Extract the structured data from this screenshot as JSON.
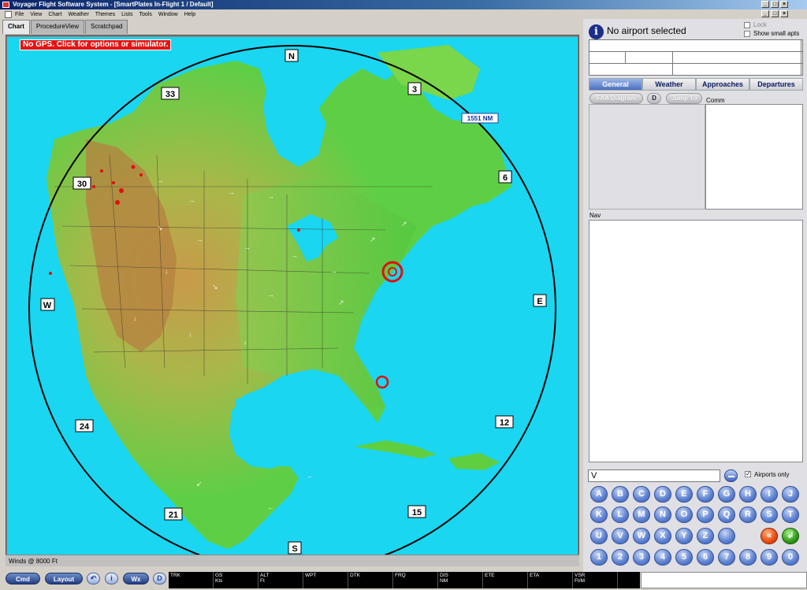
{
  "window": {
    "title": "Voyager Flight Software System - [SmartPlates In-Flight 1 / Default]",
    "min_glyph": "_",
    "max_glyph": "□",
    "close_glyph": "×"
  },
  "menu": [
    "File",
    "View",
    "Chart",
    "Weather",
    "Themes",
    "Lists",
    "Tools",
    "Window",
    "Help"
  ],
  "tabs": [
    {
      "label": "Chart",
      "active": true
    },
    {
      "label": "ProcedureView",
      "active": false
    },
    {
      "label": "Scratchpad",
      "active": false
    }
  ],
  "map": {
    "gps_banner": "No GPS.  Click for options or simulator.",
    "range_label": "1551 NM",
    "compass": {
      "n": "N",
      "e": "E",
      "s": "S",
      "w": "W"
    },
    "headings": [
      "3",
      "6",
      "12",
      "15",
      "21",
      "24",
      "30",
      "33"
    ],
    "winds_label": "Winds @ 8000 Ft",
    "colors": {
      "ocean": "#1ad6f0",
      "land_low": "#6ed34a",
      "land_high": "#c48a3a",
      "ring": "#000000",
      "marker": "#e01010"
    }
  },
  "toolbar": {
    "cmd": "Cmd",
    "layout": "Layout",
    "wx": "Wx",
    "cells": [
      {
        "l1": "TRK",
        "l2": ""
      },
      {
        "l1": "GS",
        "l2": "Kts"
      },
      {
        "l1": "ALT",
        "l2": "Ft"
      },
      {
        "l1": "WPT",
        "l2": ""
      },
      {
        "l1": "DTK",
        "l2": ""
      },
      {
        "l1": "FRQ",
        "l2": ""
      },
      {
        "l1": "DIS",
        "l2": "NM"
      },
      {
        "l1": "ETE",
        "l2": ""
      },
      {
        "l1": "ETA",
        "l2": ""
      },
      {
        "l1": "VSR",
        "l2": "Ft/M"
      }
    ]
  },
  "panel": {
    "info_glyph": "i",
    "title": "No airport selected",
    "lock_label": "Lock",
    "small_apts_label": "Show small apts",
    "tabs": [
      "General",
      "Weather",
      "Approaches",
      "Departures"
    ],
    "faa_diagram": "FAA Diagram",
    "jump_to": "Jump To",
    "comm_label": "Comm",
    "nav_label": "Nav",
    "search_value": "V",
    "airports_only_label": "Airports only",
    "airports_only_checked": true,
    "keys_row1": [
      "A",
      "B",
      "C",
      "D",
      "E",
      "F",
      "G",
      "H",
      "I",
      "J"
    ],
    "keys_row2": [
      "K",
      "L",
      "M",
      "N",
      "O",
      "P",
      "Q",
      "R",
      "S",
      "T"
    ],
    "keys_row3": [
      "U",
      "V",
      "W",
      "X",
      "Y",
      "Z"
    ],
    "backspace": "«",
    "enter": "↲",
    "digits": [
      "1",
      "2",
      "3",
      "4",
      "5",
      "6",
      "7",
      "8",
      "9",
      "0"
    ]
  }
}
